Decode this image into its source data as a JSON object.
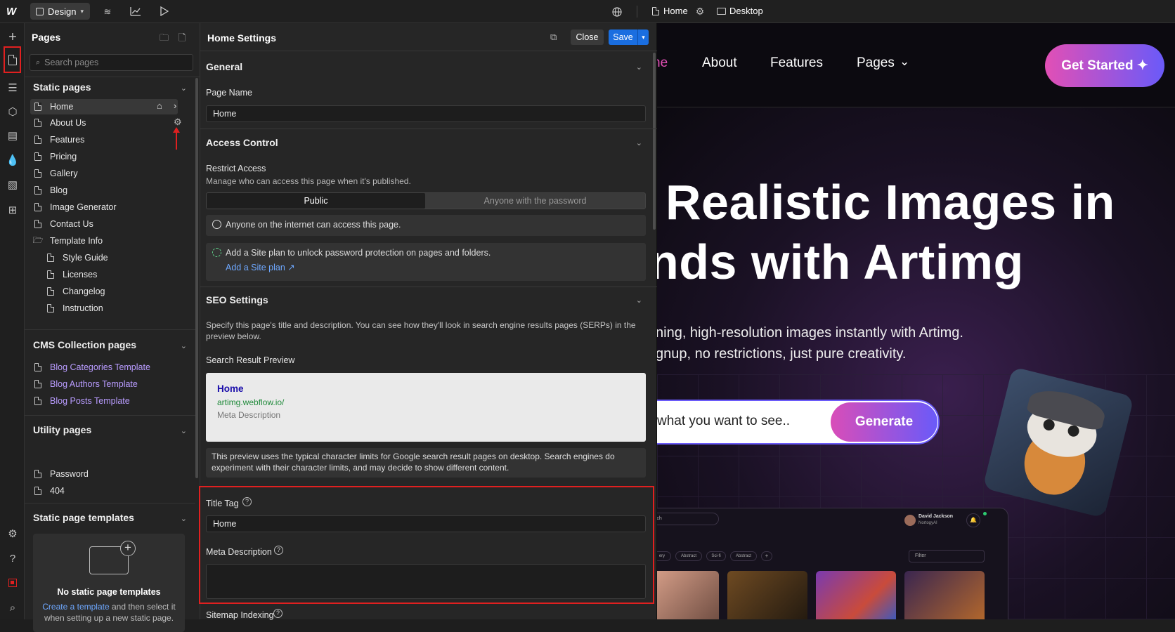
{
  "topbar": {
    "design_label": "Design",
    "page_name": "Home",
    "device_label": "Desktop"
  },
  "pages_panel": {
    "title": "Pages",
    "search_placeholder": "Search pages",
    "static_title": "Static pages",
    "static_items": [
      "Home",
      "About Us",
      "Features",
      "Pricing",
      "Gallery",
      "Blog",
      "Image Generator",
      "Contact Us",
      "Template Info"
    ],
    "template_info_children": [
      "Style Guide",
      "Licenses",
      "Changelog",
      "Instruction"
    ],
    "cms_title": "CMS Collection pages",
    "cms_items": [
      "Blog Categories Template",
      "Blog Authors Template",
      "Blog Posts Template"
    ],
    "utility_title": "Utility pages",
    "utility_items": [
      "Password",
      "404"
    ],
    "templates_title": "Static page templates",
    "templates_empty_title": "No static page templates",
    "templates_empty_link": "Create a template",
    "templates_empty_rest_1": " and then select it",
    "templates_empty_rest_2": "when setting up a new static page."
  },
  "settings": {
    "title": "Home Settings",
    "close_label": "Close",
    "save_label": "Save",
    "general_title": "General",
    "page_name_label": "Page Name",
    "page_name_value": "Home",
    "access_title": "Access Control",
    "restrict_label": "Restrict Access",
    "restrict_desc": "Manage who can access this page when it's published.",
    "seg_public": "Public",
    "seg_password": "Anyone with the password",
    "public_note": "Anyone on the internet can access this page.",
    "plan_note": "Add a Site plan to unlock password protection on pages and folders.",
    "plan_link": "Add a Site plan ↗",
    "seo_title": "SEO Settings",
    "seo_desc_1": "Specify this page's title and description. You can see how they'll look in search engine results pages (SERPs) in the",
    "seo_desc_2": "preview below.",
    "preview_label": "Search Result Preview",
    "preview_title": "Home",
    "preview_url": "artimg.webflow.io/",
    "preview_meta": "Meta Description",
    "preview_note_1": "This preview uses the typical character limits for Google search result pages on desktop. Search engines do",
    "preview_note_2": "experiment with their character limits, and may decide to show different content.",
    "title_tag_label": "Title Tag",
    "title_tag_value": "Home",
    "meta_desc_label": "Meta Description",
    "meta_desc_value": "",
    "sitemap_label": "Sitemap Indexing"
  },
  "canvas": {
    "nav_home_partial": "ne",
    "nav_about": "About",
    "nav_features": "Features",
    "nav_pages": "Pages",
    "cta": "Get Started ✦",
    "headline_1": "Realistic Images in",
    "headline_2": "nds with Artimg",
    "subline_1": "ning, high-resolution images instantly with Artimg.",
    "subline_2": "gnup, no restrictions, just pure creativity.",
    "prompt_placeholder": "what you want to see..",
    "generate_label": "Generate",
    "mock_search": "rch",
    "mock_user_name": "David Jackson",
    "mock_user_sub": "NortogyAI",
    "mock_tags": [
      "ery",
      "Abstract",
      "Sci-fi",
      "Abstract",
      "+"
    ],
    "mock_filter": "Filter"
  },
  "colors": {
    "accent_blue": "#1a6ee0",
    "annotation_red": "#e02020",
    "cms_purple": "#b99cff",
    "gradient_start": "#e24fb5",
    "gradient_end": "#6a5af9"
  }
}
